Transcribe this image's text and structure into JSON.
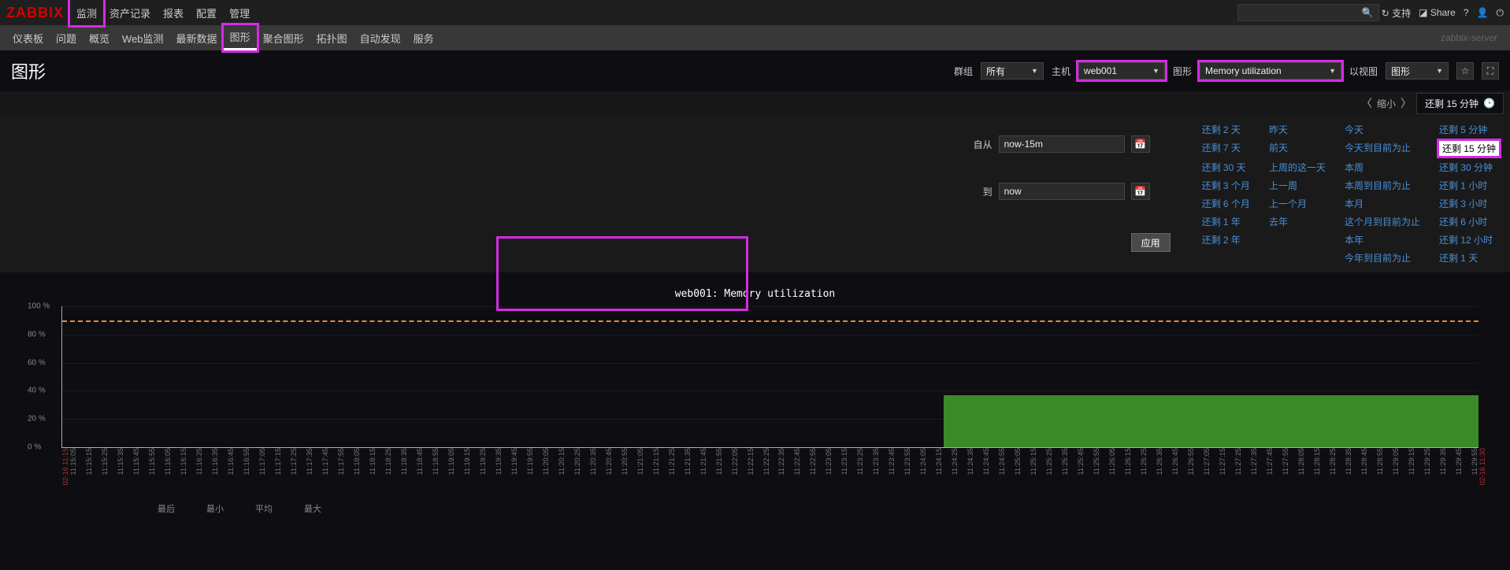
{
  "logo": "ZABBIX",
  "topnav": [
    "监测",
    "资产记录",
    "报表",
    "配置",
    "管理"
  ],
  "topnav_active": 0,
  "support": "支持",
  "share": "Share",
  "subnav": [
    "仪表板",
    "问题",
    "概览",
    "Web监测",
    "最新数据",
    "图形",
    "聚合图形",
    "拓扑图",
    "自动发现",
    "服务"
  ],
  "subnav_active": 5,
  "server_name": "zabbix-server",
  "page_title": "图形",
  "filters": {
    "group_label": "群组",
    "group_value": "所有",
    "host_label": "主机",
    "host_value": "web001",
    "graph_label": "图形",
    "graph_value": "Memory utilization",
    "view_label": "以视图",
    "view_value": "图形"
  },
  "timebar": {
    "zoom": "缩小",
    "range": "还剩 15 分钟"
  },
  "timeinputs": {
    "from_label": "自从",
    "from": "now-15m",
    "to_label": "到",
    "to": "now",
    "apply": "应用"
  },
  "presets": [
    [
      "还剩 2 天",
      "昨天",
      "今天",
      "还剩 5 分钟"
    ],
    [
      "还剩 7 天",
      "前天",
      "今天到目前为止",
      "还剩 15 分钟"
    ],
    [
      "还剩 30 天",
      "上周的这一天",
      "本周",
      "还剩 30 分钟"
    ],
    [
      "还剩 3 个月",
      "上一周",
      "本周到目前为止",
      "还剩 1 小时"
    ],
    [
      "还剩 6 个月",
      "上一个月",
      "本月",
      "还剩 3 小时"
    ],
    [
      "还剩 1 年",
      "去年",
      "这个月到目前为止",
      "还剩 6 小时"
    ],
    [
      "还剩 2 年",
      "",
      "本年",
      "还剩 12 小时"
    ],
    [
      "",
      "",
      "今年到目前为止",
      "还剩 1 天"
    ]
  ],
  "preset_active": [
    1,
    3
  ],
  "chart_data": {
    "type": "area",
    "title": "web001: Memory utilization",
    "ylabel": "%",
    "ylim": [
      0,
      100
    ],
    "yticks": [
      0,
      20,
      40,
      60,
      80,
      100
    ],
    "threshold": 90,
    "x_start": "02-16 11:15",
    "x_end": "02-16 11:30",
    "x_major": [
      "11:15",
      "11:16",
      "11:17",
      "11:18",
      "11:19",
      "11:20",
      "11:21",
      "11:22",
      "11:23",
      "11:24",
      "11:25",
      "11:26",
      "11:27",
      "11:28",
      "11:29",
      "11:30"
    ],
    "series": [
      {
        "name": "Memory utilization",
        "from": "11:24:20",
        "to": "11:30:00",
        "value": 37
      }
    ]
  },
  "stats": [
    "最后",
    "最小",
    "平均",
    "最大"
  ]
}
